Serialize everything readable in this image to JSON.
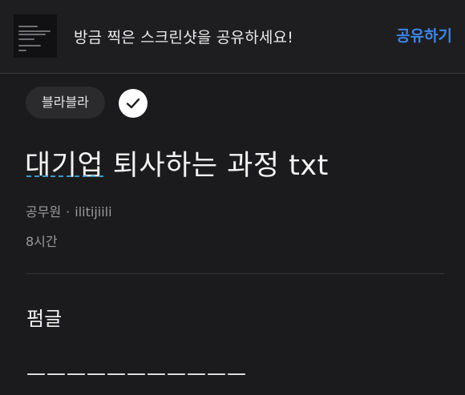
{
  "share_banner": {
    "message": "방금 찍은 스크린샷을 공유하세요!",
    "share_label": "공유하기",
    "accent_color": "#3b86e8"
  },
  "post": {
    "category": "블라블라",
    "verified_icon": "check-icon",
    "title": "대기업 퇴사하는 과정 txt",
    "author_company": "공무원",
    "author_separator": "·",
    "author_nickname": "ilitijiili",
    "time_ago": "8시간",
    "body_line_1": "펌글",
    "body_line_2": "———————————"
  }
}
